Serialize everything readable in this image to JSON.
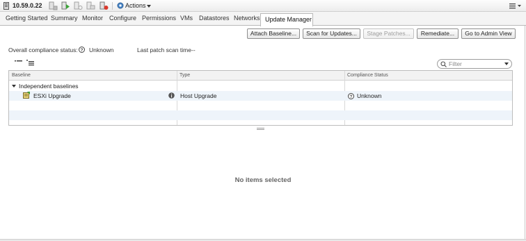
{
  "window": {
    "host_name": "10.59.0.22",
    "actions_label": "Actions"
  },
  "toolbar_icons": [
    "host-add-icon",
    "host-green-icon",
    "host-sync-icon",
    "host-folder-icon",
    "host-alarm-icon",
    "actions-gear-icon"
  ],
  "tabs": [
    {
      "label": "Getting Started",
      "active": false
    },
    {
      "label": "Summary",
      "active": false
    },
    {
      "label": "Monitor",
      "active": false
    },
    {
      "label": "Configure",
      "active": false
    },
    {
      "label": "Permissions",
      "active": false
    },
    {
      "label": "VMs",
      "active": false
    },
    {
      "label": "Datastores",
      "active": false
    },
    {
      "label": "Networks",
      "active": false
    },
    {
      "label": "Update Manager",
      "active": true
    }
  ],
  "buttons": {
    "attach_baseline": "Attach Baseline...",
    "scan_for_updates": "Scan for Updates...",
    "stage_patches": "Stage Patches...",
    "remediate": "Remediate...",
    "go_to_admin_view": "Go to Admin View"
  },
  "compliance": {
    "label": "Overall compliance status:",
    "value": "Unknown",
    "scan_label": "Last patch scan time",
    "scan_value": "--"
  },
  "filter": {
    "placeholder": "Filter",
    "value": ""
  },
  "grid": {
    "columns": [
      "Baseline",
      "Type",
      "Compliance Status"
    ],
    "group": "Independent baselines",
    "rows": [
      {
        "baseline": "ESXi Upgrade",
        "type": "Host Upgrade",
        "status": "Unknown"
      }
    ]
  },
  "empty_state": "No items selected",
  "colors": {
    "accent": "#3a7fc1",
    "active_tab_bg": "#ffffff",
    "row_highlight": "#eef4fa"
  }
}
